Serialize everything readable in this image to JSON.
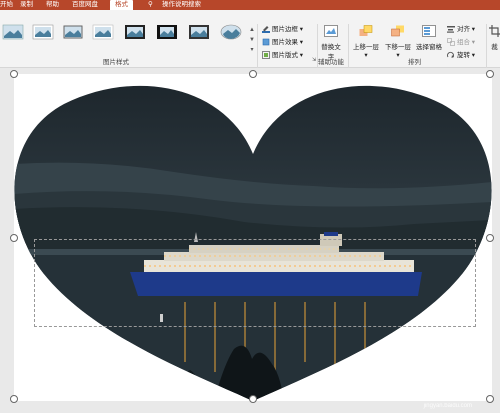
{
  "tabs": [
    {
      "label": "开始",
      "active": false
    },
    {
      "label": "录制",
      "active": false
    },
    {
      "label": "帮助",
      "active": false
    },
    {
      "label": "百度网盘",
      "active": false
    },
    {
      "label": "格式",
      "active": true
    },
    {
      "label": "操作说明搜索",
      "active": false
    }
  ],
  "ribbon": {
    "picture_styles": {
      "label": "图片样式"
    },
    "picture_commands": {
      "border": "图片边框",
      "effects": "图片效果",
      "layout": "图片版式"
    },
    "accessibility": {
      "label": "辅助功能",
      "alt_text": "替换文字"
    },
    "arrange": {
      "label": "排列",
      "bring_forward": "上移一层",
      "send_backward": "下移一层",
      "selection_pane": "选择窗格",
      "align": "对齐",
      "group": "组合",
      "rotate": "旋转"
    },
    "crop_label": "裁"
  },
  "watermark": {
    "main": "Bai 经验",
    "sub": "jingyan.baidu.com"
  },
  "colors": {
    "accent": "#b7472a",
    "ribbon_bg": "#f3f3f3",
    "canvas_bg": "#e9e9e9"
  }
}
